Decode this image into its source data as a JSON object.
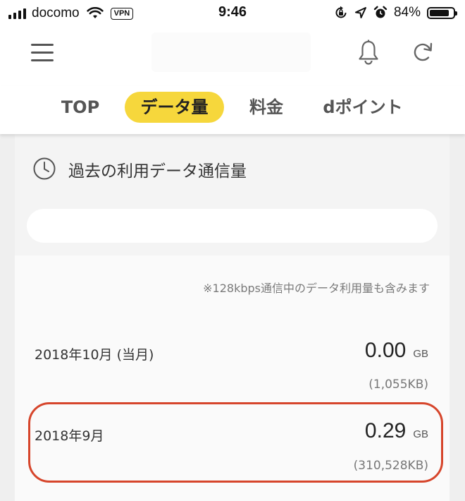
{
  "status_bar": {
    "carrier": "docomo",
    "vpn": "VPN",
    "time": "9:46",
    "battery": "84%",
    "battery_level": 0.84
  },
  "header": {
    "menu_icon": "hamburger-menu-icon",
    "bell_icon": "bell-icon",
    "refresh_icon": "refresh-icon"
  },
  "tabs": [
    {
      "label": "TOP",
      "active": false
    },
    {
      "label": "データ量",
      "active": true
    },
    {
      "label": "料金",
      "active": false
    },
    {
      "label": "dポイント",
      "active": false
    }
  ],
  "card": {
    "title": "過去の利用データ通信量",
    "icon": "clock-icon",
    "note": "※128kbps通信中のデータ利用量も含みます",
    "rows": [
      {
        "month": "2018年10月 (当月)",
        "value": "0.00",
        "unit": "GB",
        "kb": "(1,055KB)"
      },
      {
        "month": "2018年9月",
        "value": "0.29",
        "unit": "GB",
        "kb": "(310,528KB)"
      }
    ]
  },
  "colors": {
    "accent_yellow": "#f6d73c",
    "highlight_red": "#d6452b"
  }
}
